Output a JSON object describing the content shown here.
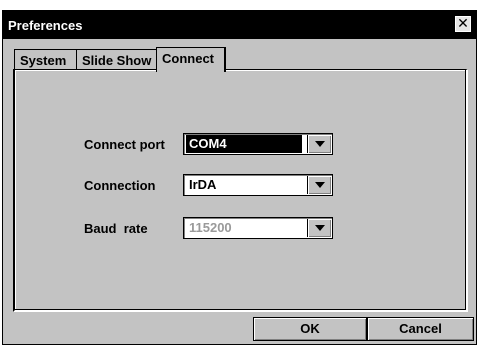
{
  "window": {
    "title": "Preferences"
  },
  "tabs": [
    {
      "label": "System"
    },
    {
      "label": "Slide Show"
    },
    {
      "label": "Connect",
      "active": true
    }
  ],
  "form": {
    "connect_port": {
      "label": "Connect port",
      "value": "COM4",
      "state": "focused"
    },
    "connection": {
      "label": "Connection",
      "value": "IrDA",
      "state": "normal"
    },
    "baud_rate": {
      "label": "Baud  rate",
      "value": "115200",
      "state": "disabled"
    }
  },
  "buttons": {
    "ok": "OK",
    "cancel": "Cancel"
  },
  "icons": {
    "close": "close-icon",
    "dropdown": "chevron-down-icon"
  },
  "colors": {
    "titlebar": "#000000",
    "face": "#c3c3c3",
    "highlight": "#000000",
    "disabled_text": "#9a9a9a"
  }
}
